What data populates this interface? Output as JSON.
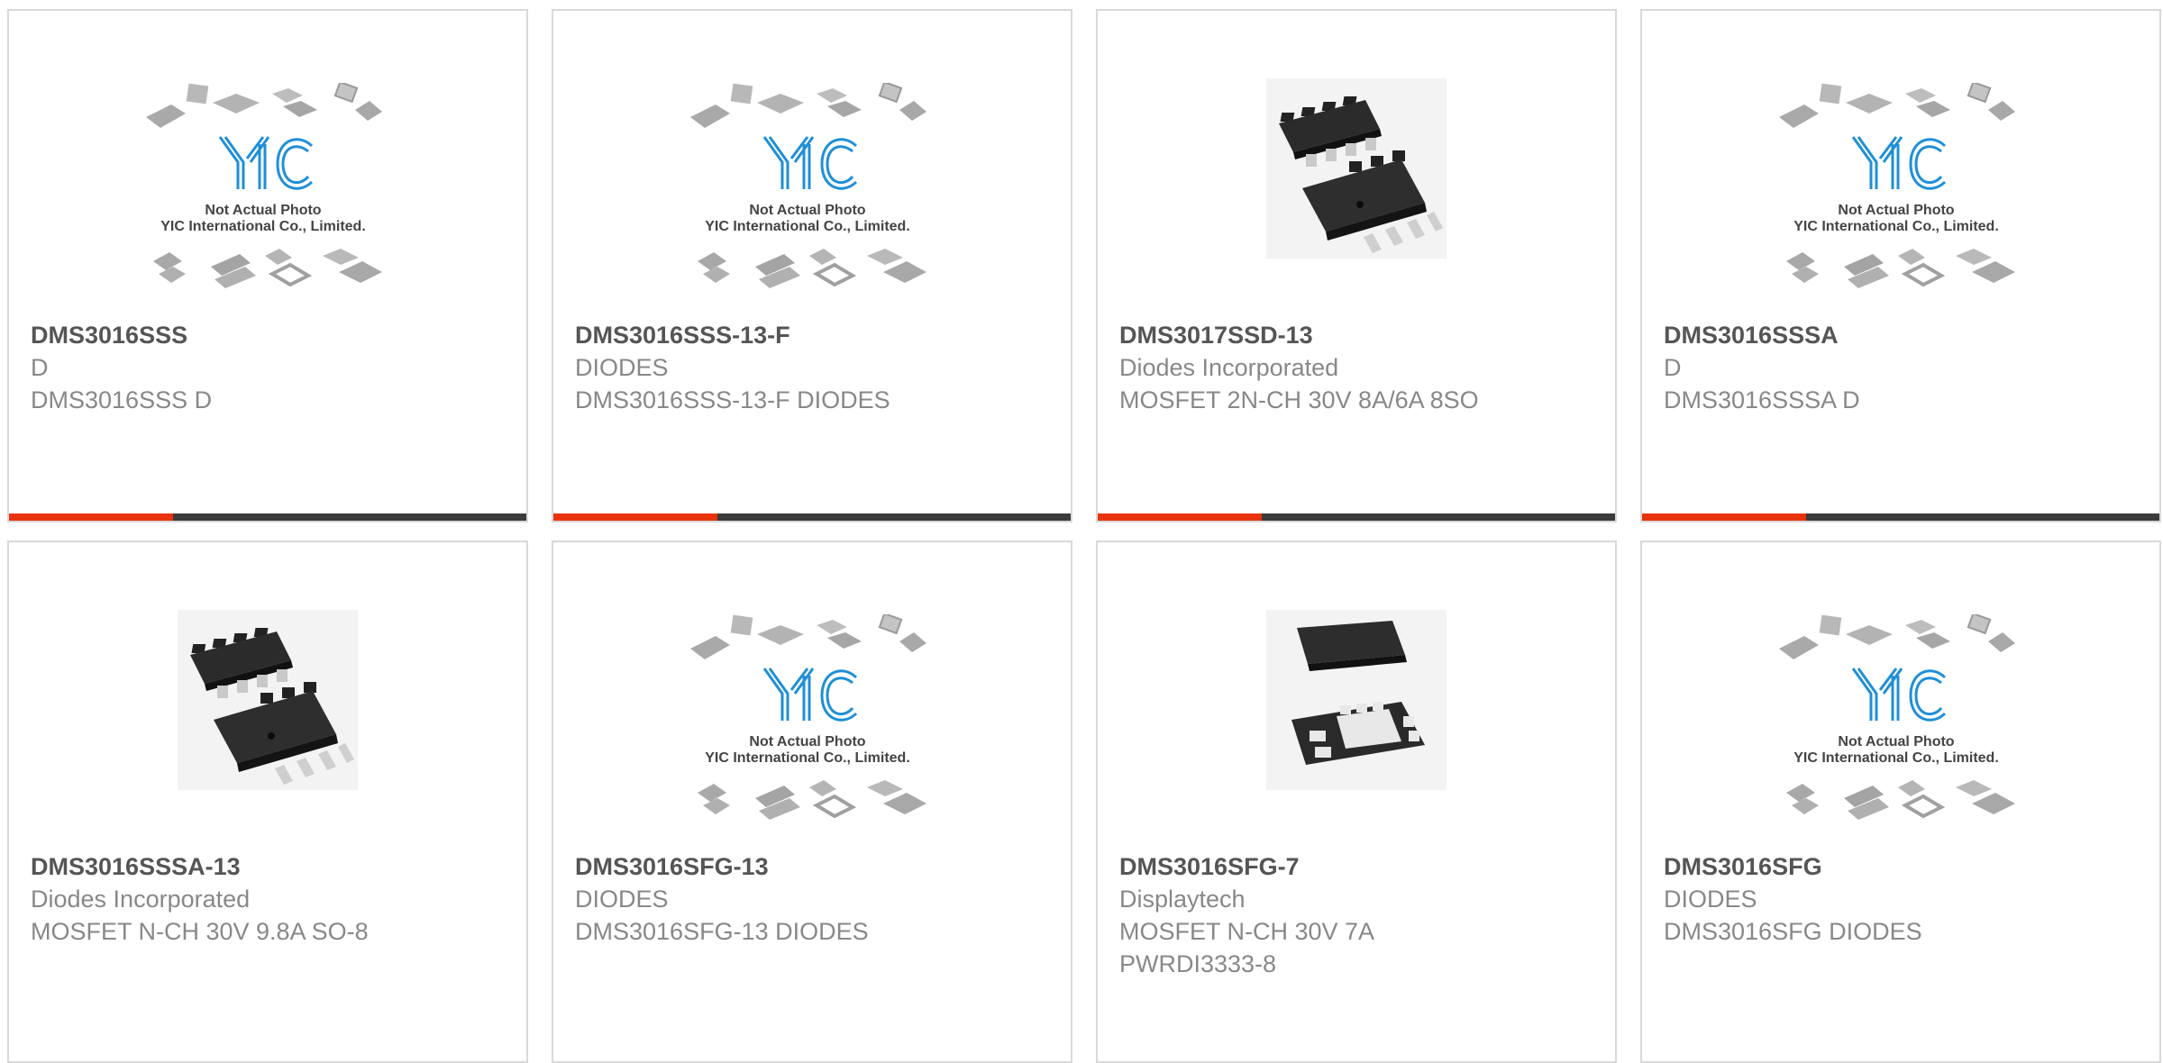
{
  "colors": {
    "accent": "#e8330c",
    "bar": "#3b3b3b",
    "border": "#d9d9d9",
    "part_number": "#555555",
    "text": "#888888",
    "logo_blue": "#1f8fd6"
  },
  "placeholder": {
    "logo": "YIC",
    "line1": "Not Actual Photo",
    "line2": "YIC International Co., Limited."
  },
  "products": [
    {
      "part_number": "DMS3016SSS",
      "manufacturer": "D",
      "description": "DMS3016SSS D",
      "image": "yic-placeholder-icon"
    },
    {
      "part_number": "DMS3016SSS-13-F",
      "manufacturer": "DIODES",
      "description": "DMS3016SSS-13-F DIODES",
      "image": "yic-placeholder-icon"
    },
    {
      "part_number": "DMS3017SSD-13",
      "manufacturer": "Diodes Incorporated",
      "description": "MOSFET 2N-CH 30V 8A/6A 8SO",
      "image": "so8-chip-icon"
    },
    {
      "part_number": "DMS3016SSSA",
      "manufacturer": "D",
      "description": "DMS3016SSSA D",
      "image": "yic-placeholder-icon"
    },
    {
      "part_number": "DMS3016SSSA-13",
      "manufacturer": "Diodes Incorporated",
      "description": "MOSFET N-CH 30V 9.8A SO-8",
      "image": "so8-chip-icon"
    },
    {
      "part_number": "DMS3016SFG-13",
      "manufacturer": "DIODES",
      "description": "DMS3016SFG-13 DIODES",
      "image": "yic-placeholder-icon"
    },
    {
      "part_number": "DMS3016SFG-7",
      "manufacturer": "Displaytech",
      "description": "MOSFET N-CH 30V 7A PWRDI3333-8",
      "image": "dfn-chip-icon"
    },
    {
      "part_number": "DMS3016SFG",
      "manufacturer": "DIODES",
      "description": "DMS3016SFG DIODES",
      "image": "yic-placeholder-icon"
    }
  ]
}
